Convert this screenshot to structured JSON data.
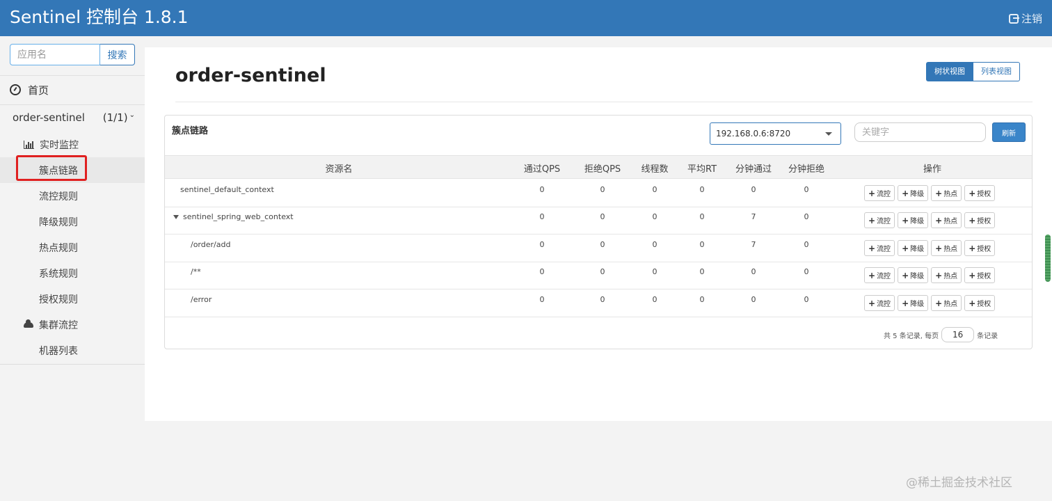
{
  "header": {
    "brand": "Sentinel 控制台 1.8.1",
    "logout_label": "注销"
  },
  "sidebar": {
    "search_placeholder": "应用名",
    "search_button": "搜索",
    "home_label": "首页",
    "app": {
      "name": "order-sentinel",
      "count": "(1/1)"
    },
    "items": [
      {
        "label": "实时监控",
        "icon": "bar-chart-icon"
      },
      {
        "label": "簇点链路",
        "active": true
      },
      {
        "label": "流控规则"
      },
      {
        "label": "降级规则"
      },
      {
        "label": "热点规则"
      },
      {
        "label": "系统规则"
      },
      {
        "label": "授权规则"
      },
      {
        "label": "集群流控",
        "icon": "cloud-icon"
      },
      {
        "label": "机器列表"
      }
    ]
  },
  "main": {
    "title": "order-sentinel",
    "view_tree": "树状视图",
    "view_list": "列表视图",
    "panel_title": "簇点链路",
    "machine": "192.168.0.6:8720",
    "keyword_placeholder": "关键字",
    "refresh_button": "刷新",
    "columns": [
      "资源名",
      "通过QPS",
      "拒绝QPS",
      "线程数",
      "平均RT",
      "分钟通过",
      "分钟拒绝",
      "操作"
    ],
    "ops": [
      "流控",
      "降级",
      "热点",
      "授权"
    ],
    "rows": [
      {
        "name": "sentinel_default_context",
        "pass_qps": "0",
        "block_qps": "0",
        "threads": "0",
        "avg_rt": "0",
        "min_pass": "0",
        "min_block": "0"
      },
      {
        "name": "sentinel_spring_web_context",
        "pass_qps": "0",
        "block_qps": "0",
        "threads": "0",
        "avg_rt": "0",
        "min_pass": "7",
        "min_block": "0"
      },
      {
        "name": "/order/add",
        "pass_qps": "0",
        "block_qps": "0",
        "threads": "0",
        "avg_rt": "0",
        "min_pass": "7",
        "min_block": "0"
      },
      {
        "name": "/**",
        "pass_qps": "0",
        "block_qps": "0",
        "threads": "0",
        "avg_rt": "0",
        "min_pass": "0",
        "min_block": "0"
      },
      {
        "name": "/error",
        "pass_qps": "0",
        "block_qps": "0",
        "threads": "0",
        "avg_rt": "0",
        "min_pass": "0",
        "min_block": "0"
      }
    ],
    "pager": {
      "prefix": "共 5 条记录, 每页",
      "page_size": "16",
      "suffix": "条记录"
    }
  },
  "watermark": "@稀土掘金技术社区",
  "colors": {
    "brand": "#3377b7",
    "highlight": "#e02020"
  }
}
